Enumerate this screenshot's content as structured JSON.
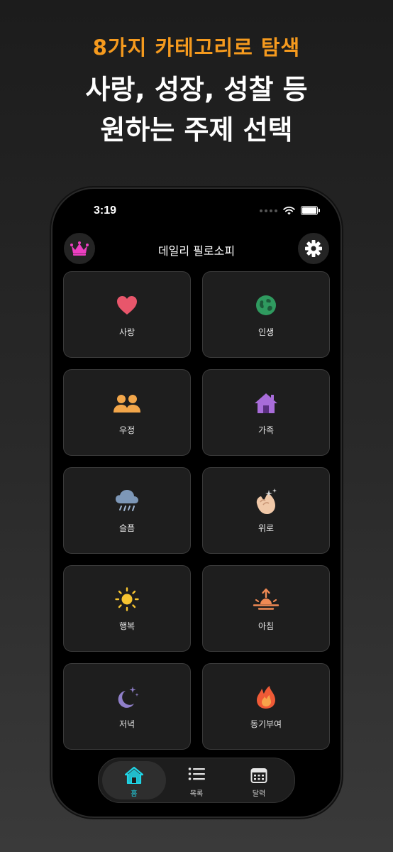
{
  "promo": {
    "subtitle": "8가지 카테고리로 탐색",
    "title_line1": "사랑, 성장, 성찰 등",
    "title_line2": "원하는 주제 선택",
    "accent_color": "#f59a1e"
  },
  "status_bar": {
    "time": "3:19"
  },
  "header": {
    "title": "데일리 필로소피",
    "left_icon": "crown-icon",
    "right_icon": "gear-icon"
  },
  "categories": [
    {
      "label": "사랑",
      "icon": "heart-icon"
    },
    {
      "label": "인생",
      "icon": "globe-icon"
    },
    {
      "label": "우정",
      "icon": "people-icon"
    },
    {
      "label": "가족",
      "icon": "house-icon"
    },
    {
      "label": "슬픔",
      "icon": "rain-cloud-icon"
    },
    {
      "label": "위로",
      "icon": "clapping-hands-icon"
    },
    {
      "label": "행복",
      "icon": "sun-icon"
    },
    {
      "label": "아침",
      "icon": "sunrise-icon"
    },
    {
      "label": "저녁",
      "icon": "moon-stars-icon"
    },
    {
      "label": "동기부여",
      "icon": "fire-icon"
    }
  ],
  "tab_bar": {
    "active_color": "#1fd5e6",
    "tabs": [
      {
        "label": "홈",
        "icon": "home-icon",
        "active": true
      },
      {
        "label": "목록",
        "icon": "list-icon",
        "active": false
      },
      {
        "label": "달력",
        "icon": "calendar-icon",
        "active": false
      }
    ]
  }
}
